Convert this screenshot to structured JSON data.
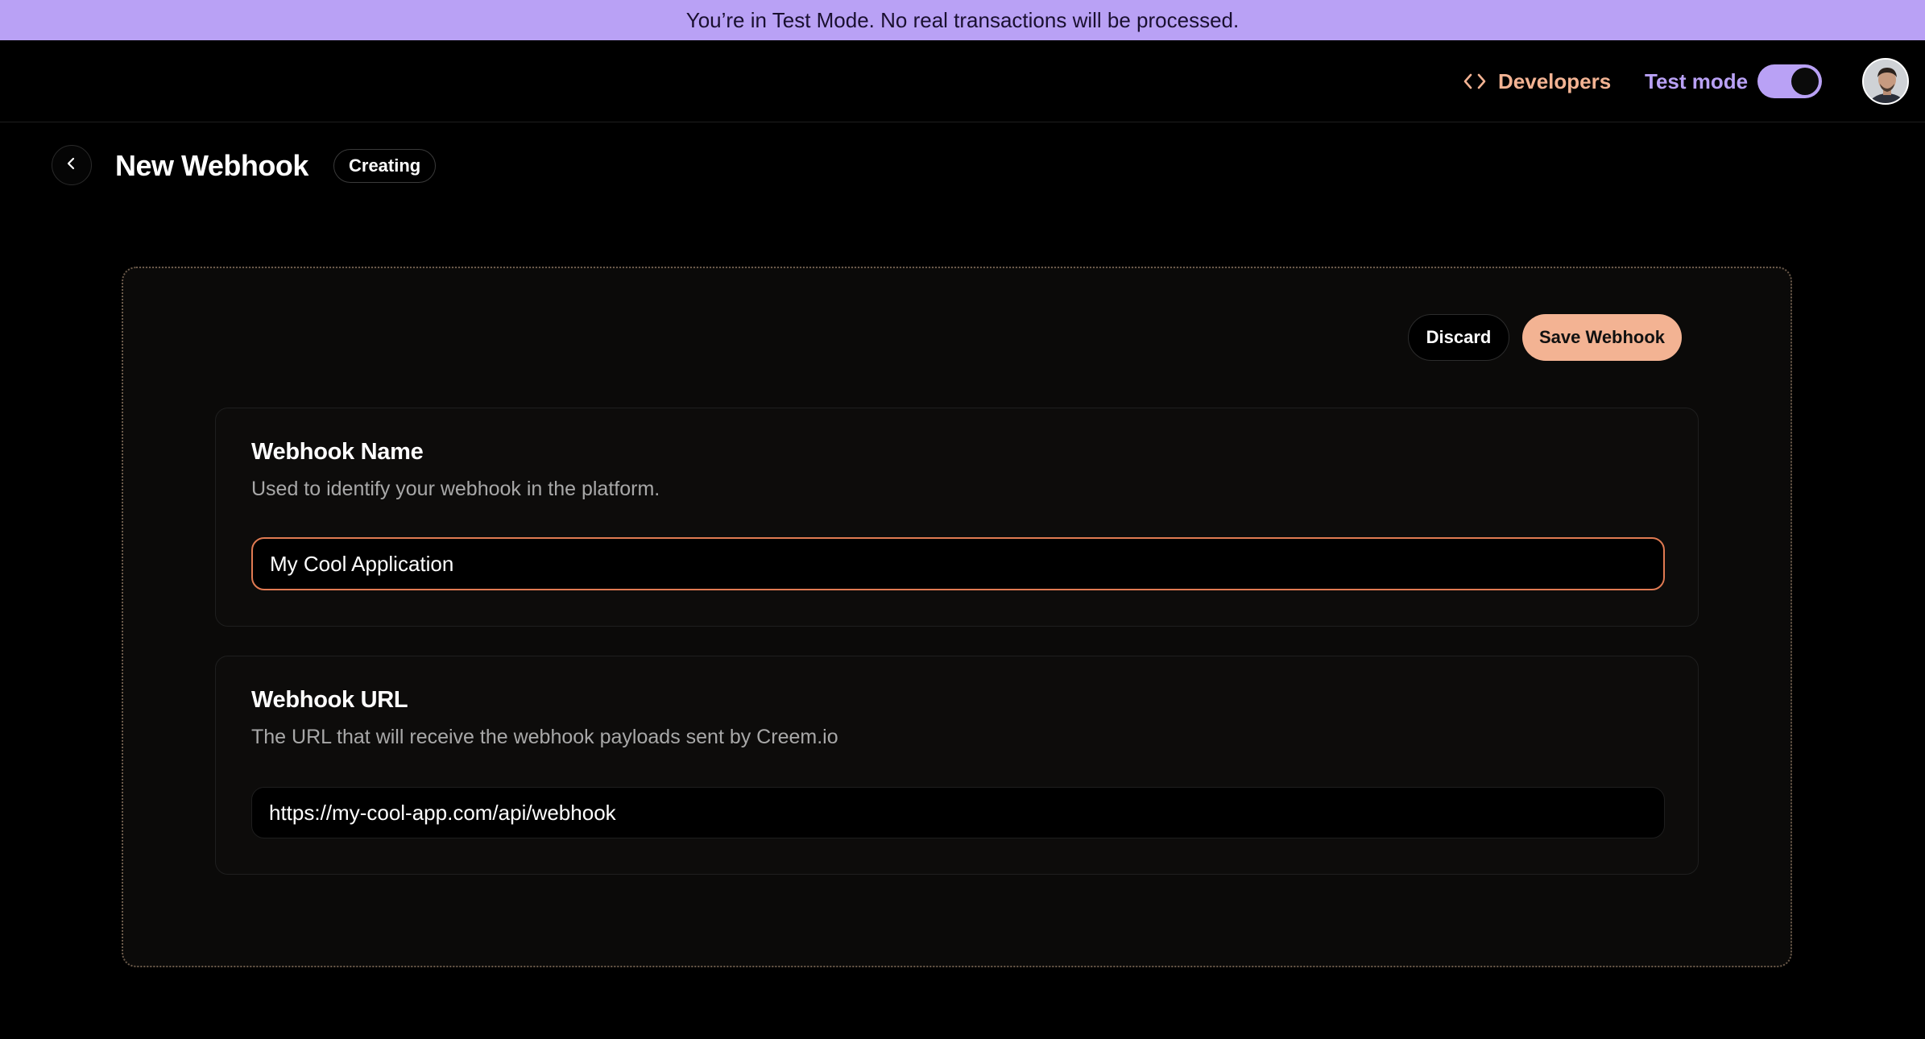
{
  "banner": {
    "text": "You’re in Test Mode. No real transactions will be processed."
  },
  "header": {
    "developers_label": "Developers",
    "developers_icon": "code-brackets-icon",
    "test_mode_label": "Test mode",
    "test_mode_on": true,
    "avatar_icon": "user-avatar"
  },
  "page": {
    "back_icon": "chevron-left-icon",
    "title": "New Webhook",
    "status": "Creating"
  },
  "actions": {
    "discard_label": "Discard",
    "save_label": "Save Webhook"
  },
  "form": {
    "name": {
      "title": "Webhook Name",
      "description": "Used to identify your webhook in the platform.",
      "value": "My Cool Application"
    },
    "url": {
      "title": "Webhook URL",
      "description": "The URL that will receive the webhook payloads sent by Creem.io",
      "value": "https://my-cool-app.com/api/webhook"
    }
  },
  "colors": {
    "banner_bg": "#b9a1f5",
    "accent_peach": "#f3b393",
    "accent_purple": "#b9a1f5",
    "focus_border": "#e07a52",
    "background": "#000000"
  }
}
